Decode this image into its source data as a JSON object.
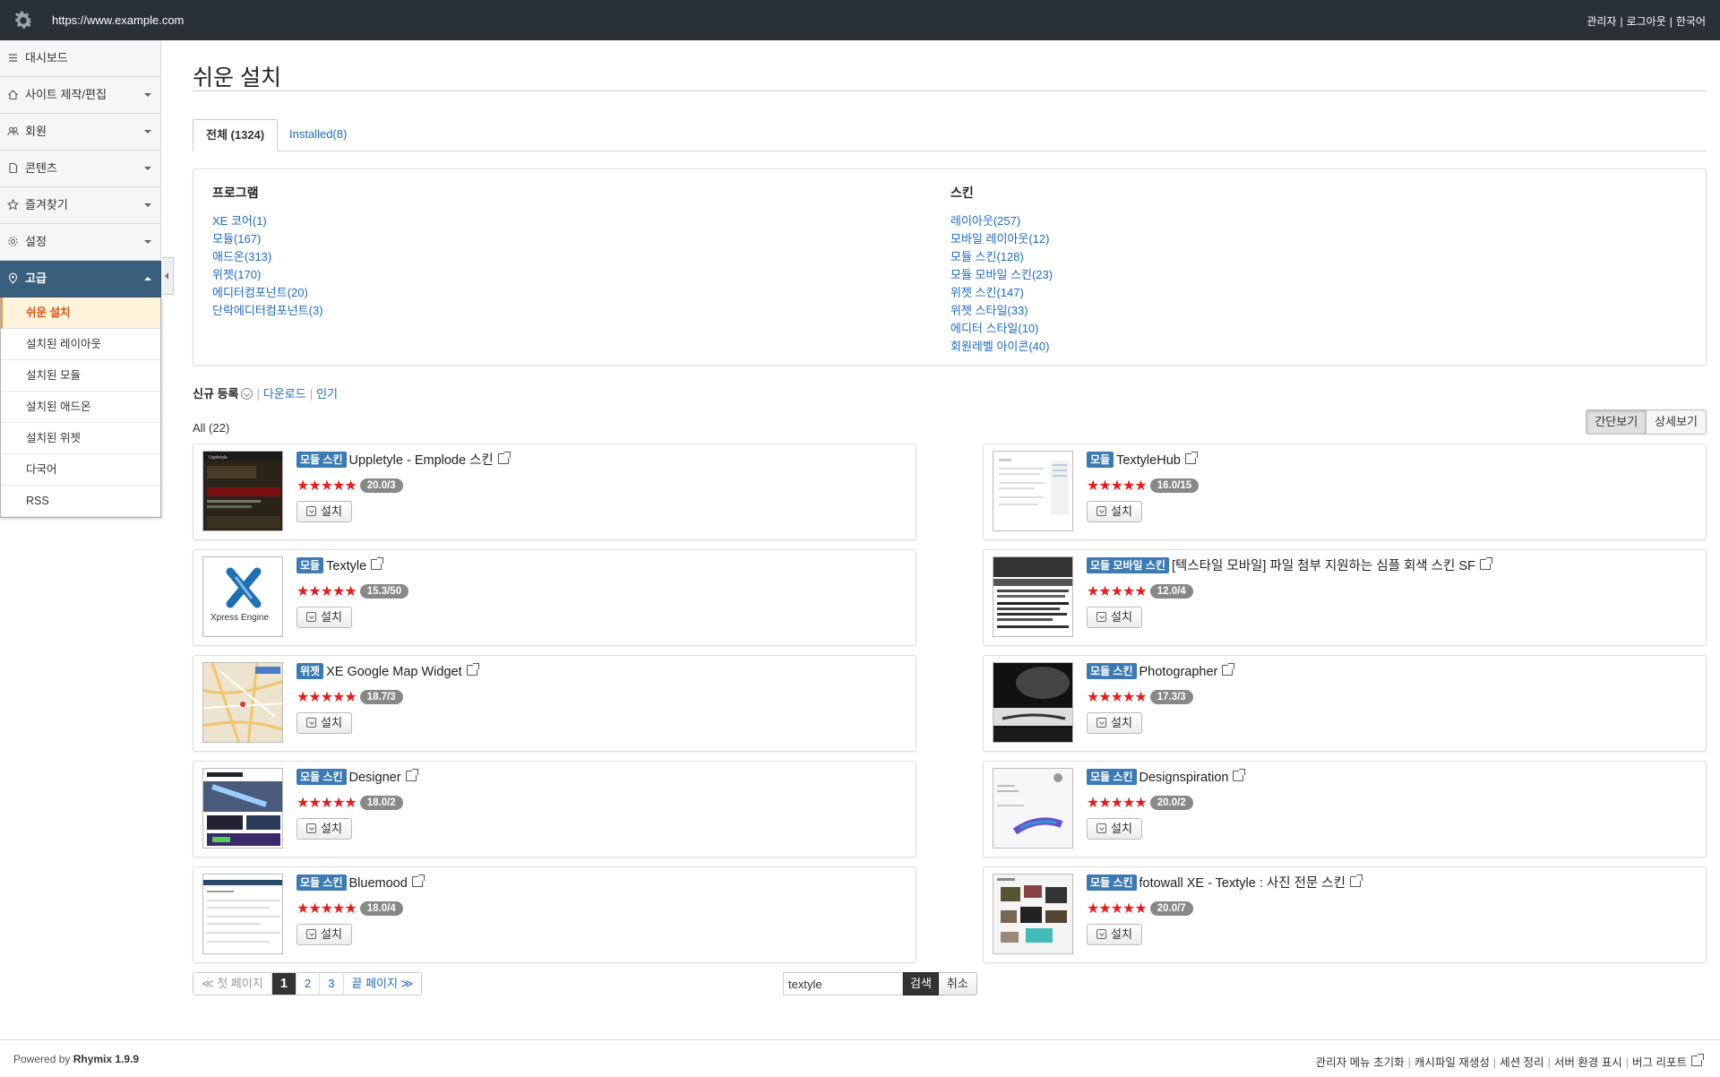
{
  "topbar": {
    "url": "https://www.example.com",
    "admin": "관리자",
    "logout": "로그아웃",
    "language": "한국어"
  },
  "sidebar": {
    "items": [
      {
        "label": "대시보드"
      },
      {
        "label": "사이트 제작/편집"
      },
      {
        "label": "회원"
      },
      {
        "label": "콘텐츠"
      },
      {
        "label": "즐겨찾기"
      },
      {
        "label": "설정"
      },
      {
        "label": "고급"
      }
    ],
    "sub_items": [
      {
        "label": "쉬운 설치"
      },
      {
        "label": "설치된 레이아웃"
      },
      {
        "label": "설치된 모듈"
      },
      {
        "label": "설치된 애드온"
      },
      {
        "label": "설치된 위젯"
      },
      {
        "label": "다국어"
      },
      {
        "label": "RSS"
      }
    ]
  },
  "page": {
    "title": "쉬운 설치",
    "tab_all": "전체 (1324)",
    "tab_installed": "Installed(8)"
  },
  "categories": {
    "program": {
      "heading": "프로그램",
      "links": [
        "XE 코어(1)",
        "모듈(167)",
        "애드온(313)",
        "위젯(170)",
        "에디터컴포넌트(20)",
        "단락에디터컴포넌트(3)"
      ]
    },
    "skin": {
      "heading": "스킨",
      "links": [
        "레이아웃(257)",
        "모바일 레이아웃(12)",
        "모듈 스킨(128)",
        "모듈 모바일 스킨(23)",
        "위젯 스킨(147)",
        "위젯 스타일(33)",
        "에디터 스타일(10)",
        "회원레벨 아이콘(40)"
      ]
    }
  },
  "sort": {
    "current": "신규 등록",
    "download": "다운로드",
    "popular": "인기"
  },
  "list": {
    "count": "All (22)",
    "view_simple": "간단보기",
    "view_detail": "상세보기",
    "install_label": "설치",
    "stars": "★★★★★",
    "items": [
      {
        "badge": "모듈 스킨",
        "name": "Uppletyle - Emplode 스킨",
        "score": "20.0/3"
      },
      {
        "badge": "모듈",
        "name": "TextyleHub",
        "score": "16.0/15"
      },
      {
        "badge": "모듈",
        "name": "Textyle",
        "score": "15.3/50"
      },
      {
        "badge": "모듈 모바일 스킨",
        "name": "[텍스타일 모바일] 파일 첨부 지원하는 심플 회색 스킨 SF",
        "score": "12.0/4"
      },
      {
        "badge": "위젯",
        "name": "XE Google Map Widget",
        "score": "18.7/3"
      },
      {
        "badge": "모듈 스킨",
        "name": "Photographer",
        "score": "17.3/3"
      },
      {
        "badge": "모듈 스킨",
        "name": "Designer",
        "score": "18.0/2"
      },
      {
        "badge": "모듈 스킨",
        "name": "Designspiration",
        "score": "20.0/2"
      },
      {
        "badge": "모듈 스킨",
        "name": "Bluemood",
        "score": "18.0/4"
      },
      {
        "badge": "모듈 스킨",
        "name": "fotowall XE - Textyle : 사진 전문 스킨",
        "score": "20.0/7"
      }
    ]
  },
  "pager": {
    "first": "≪ 첫 페이지",
    "pages": [
      "1",
      "2",
      "3"
    ],
    "last": "끝 페이지 ≫"
  },
  "search": {
    "value": "textyle",
    "button": "검색",
    "cancel": "취소"
  },
  "footer": {
    "powered_prefix": "Powered by ",
    "powered_name": "Rhymix 1.9.9",
    "links": [
      "관리자 메뉴 초기화",
      "캐시파일 재생성",
      "세션 정리",
      "서버 환경 표시",
      "버그 리포트"
    ]
  },
  "colors": {
    "topbar": "#293038",
    "active_menu": "#3a5f7d",
    "badge": "#3a7ab5",
    "stars": "#e51d1d",
    "link": "#1b6ac9"
  }
}
